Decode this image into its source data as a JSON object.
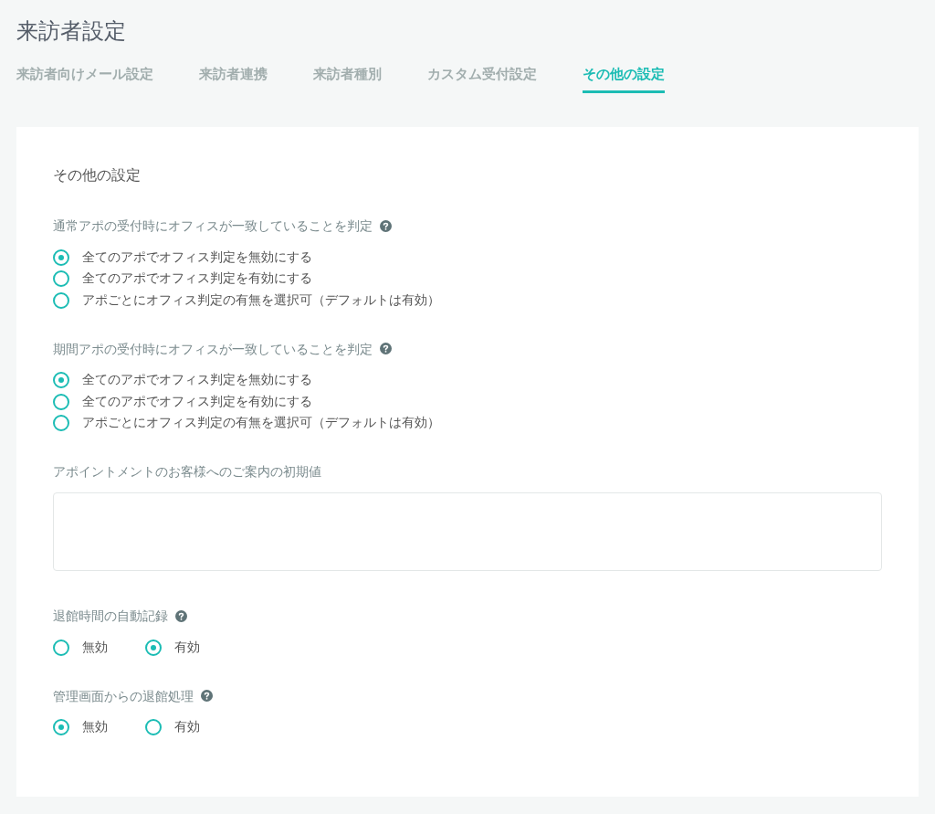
{
  "page_title": "来訪者設定",
  "tabs": [
    {
      "label": "来訪者向けメール設定",
      "selected": false
    },
    {
      "label": "来訪者連携",
      "selected": false
    },
    {
      "label": "来訪者種別",
      "selected": false
    },
    {
      "label": "カスタム受付設定",
      "selected": false
    },
    {
      "label": "その他の設定",
      "selected": true
    }
  ],
  "card": {
    "heading": "その他の設定",
    "sections": [
      {
        "kind": "radio_vertical",
        "label": "通常アポの受付時にオフィスが一致していることを判定",
        "help": true,
        "options": [
          {
            "label": "全てのアポでオフィス判定を無効にする",
            "selected": true
          },
          {
            "label": "全てのアポでオフィス判定を有効にする",
            "selected": false
          },
          {
            "label": "アポごとにオフィス判定の有無を選択可（デフォルトは有効）",
            "selected": false
          }
        ]
      },
      {
        "kind": "radio_vertical",
        "label": "期間アポの受付時にオフィスが一致していることを判定",
        "help": true,
        "options": [
          {
            "label": "全てのアポでオフィス判定を無効にする",
            "selected": true
          },
          {
            "label": "全てのアポでオフィス判定を有効にする",
            "selected": false
          },
          {
            "label": "アポごとにオフィス判定の有無を選択可（デフォルトは有効）",
            "selected": false
          }
        ]
      },
      {
        "kind": "textarea",
        "label": "アポイントメントのお客様へのご案内の初期値",
        "help": false
      },
      {
        "kind": "radio_inline",
        "label": "退館時間の自動記録",
        "help": true,
        "options": [
          {
            "label": "無効",
            "selected": false
          },
          {
            "label": "有効",
            "selected": true
          }
        ]
      },
      {
        "kind": "radio_inline",
        "label": "管理画面からの退館処理",
        "help": true,
        "options": [
          {
            "label": "無効",
            "selected": true
          },
          {
            "label": "有効",
            "selected": false
          }
        ]
      }
    ]
  }
}
